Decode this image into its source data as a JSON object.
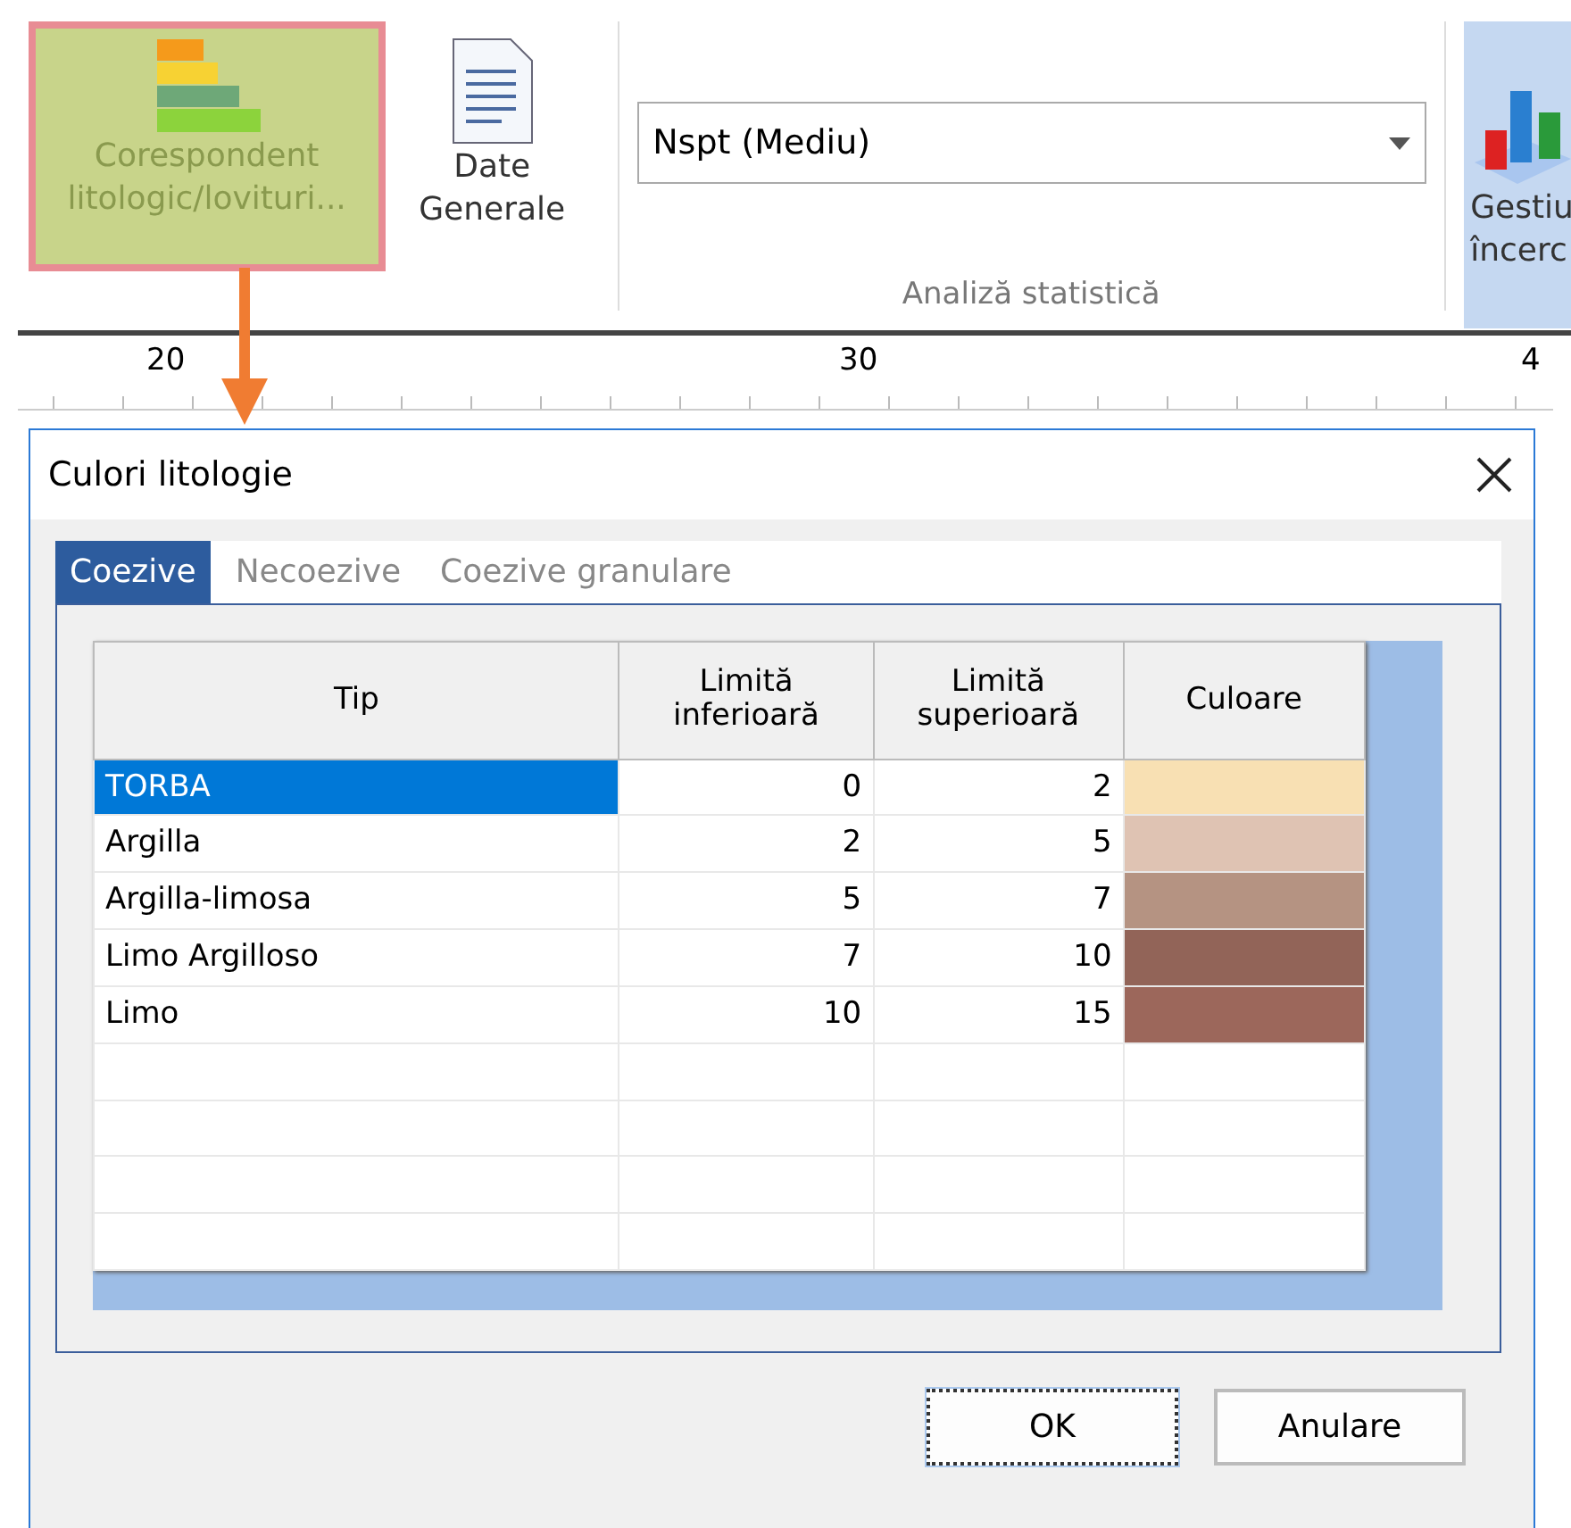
{
  "ribbon": {
    "buttons": [
      {
        "kind": "lithology",
        "label": "Corespondent litologic/lovituri...",
        "highlighted": true
      },
      {
        "kind": "document",
        "label": "Date Generale",
        "highlighted": false
      }
    ],
    "group": {
      "dropdown": {
        "value": "Nspt (Mediu)"
      },
      "label": "Analiză statistică"
    },
    "cut_button": {
      "label": "Gestiu încerc"
    }
  },
  "ruler": {
    "labels": [
      "20",
      "30",
      "4"
    ]
  },
  "dialog": {
    "title": "Culori litologie",
    "tabs": [
      {
        "label": "Coezive",
        "selected": true
      },
      {
        "label": "Necoezive",
        "selected": false
      },
      {
        "label": "Coezive granulare",
        "selected": false
      }
    ],
    "table": {
      "columns": [
        "Tip",
        "Limită inferioară",
        "Limită superioară",
        "Culoare"
      ],
      "rows": [
        {
          "tip": "TORBA",
          "lower": "0",
          "upper": "2",
          "color": "#f8e0b3",
          "selected": true
        },
        {
          "tip": "Argilla",
          "lower": "2",
          "upper": "5",
          "color": "#dfc3b3",
          "selected": false
        },
        {
          "tip": "Argilla-limosa",
          "lower": "5",
          "upper": "7",
          "color": "#b59382",
          "selected": false
        },
        {
          "tip": "Limo Argilloso",
          "lower": "7",
          "upper": "10",
          "color": "#926458",
          "selected": false
        },
        {
          "tip": "Limo",
          "lower": "10",
          "upper": "15",
          "color": "#9c675b",
          "selected": false
        }
      ]
    },
    "buttons": [
      {
        "label": "OK",
        "focused": true
      },
      {
        "label": "Anulare",
        "focused": false
      }
    ]
  }
}
